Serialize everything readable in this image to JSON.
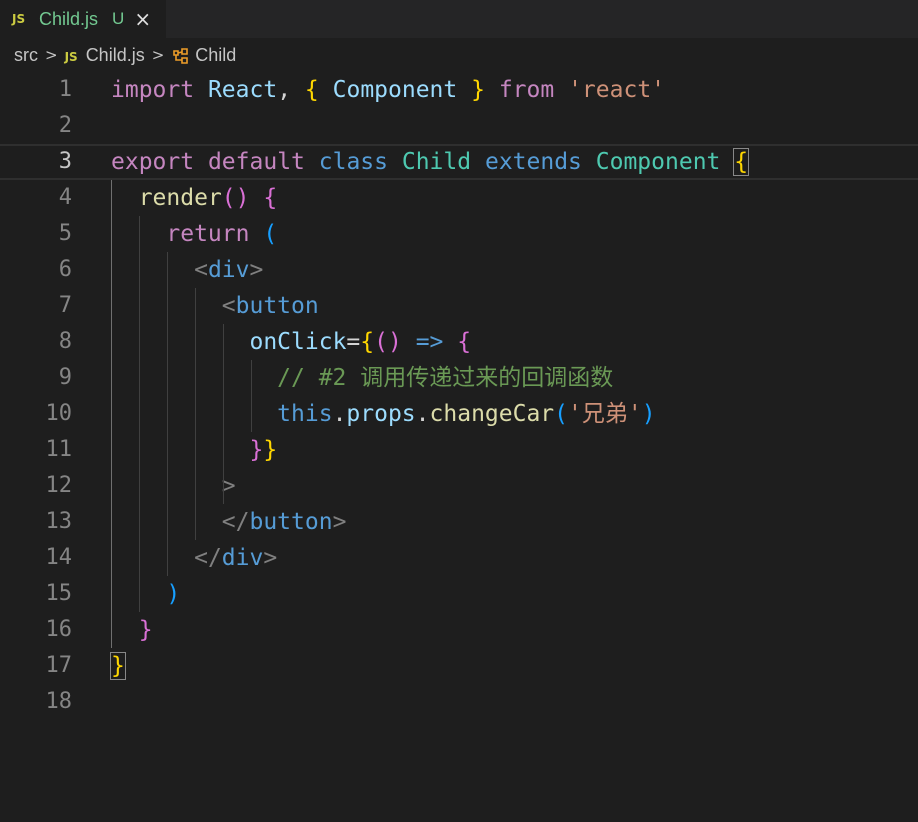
{
  "tab": {
    "badge": "JS",
    "filename": "Child.js",
    "status": "U",
    "close": "×"
  },
  "breadcrumb": {
    "folder": "src",
    "badge": "JS",
    "file": "Child.js",
    "symbol": "Child",
    "separator": ">"
  },
  "editor": {
    "active_line": 3,
    "line_numbers": [
      "1",
      "2",
      "3",
      "4",
      "5",
      "6",
      "7",
      "8",
      "9",
      "10",
      "11",
      "12",
      "13",
      "14",
      "15",
      "16",
      "17",
      "18"
    ],
    "lines": [
      [
        [
          "import",
          "kw-purple"
        ],
        [
          " ",
          "plain"
        ],
        [
          "React",
          "var"
        ],
        [
          ", ",
          "plain"
        ],
        [
          "{",
          "br1"
        ],
        [
          " ",
          "plain"
        ],
        [
          "Component",
          "var"
        ],
        [
          " ",
          "plain"
        ],
        [
          "}",
          "br1"
        ],
        [
          " ",
          "plain"
        ],
        [
          "from",
          "kw-purple"
        ],
        [
          " ",
          "plain"
        ],
        [
          "'react'",
          "str"
        ]
      ],
      [],
      [
        [
          "export",
          "kw-purple"
        ],
        [
          " ",
          "plain"
        ],
        [
          "default",
          "kw-purple"
        ],
        [
          " ",
          "plain"
        ],
        [
          "class",
          "kw-blue"
        ],
        [
          " ",
          "plain"
        ],
        [
          "Child",
          "type"
        ],
        [
          " ",
          "plain"
        ],
        [
          "extends",
          "kw-blue"
        ],
        [
          " ",
          "plain"
        ],
        [
          "Component",
          "type"
        ],
        [
          " ",
          "plain"
        ],
        [
          "{",
          "br1 bracket-match"
        ]
      ],
      [
        [
          "  ",
          "plain"
        ],
        [
          "render",
          "fn"
        ],
        [
          "()",
          "br2"
        ],
        [
          " ",
          "plain"
        ],
        [
          "{",
          "br2"
        ]
      ],
      [
        [
          "    ",
          "plain"
        ],
        [
          "return",
          "kw-purple"
        ],
        [
          " ",
          "plain"
        ],
        [
          "(",
          "br3"
        ]
      ],
      [
        [
          "      ",
          "plain"
        ],
        [
          "<",
          "angle"
        ],
        [
          "div",
          "tag"
        ],
        [
          ">",
          "angle"
        ]
      ],
      [
        [
          "        ",
          "plain"
        ],
        [
          "<",
          "angle"
        ],
        [
          "button",
          "tag"
        ]
      ],
      [
        [
          "          ",
          "plain"
        ],
        [
          "onClick",
          "var"
        ],
        [
          "=",
          "plain"
        ],
        [
          "{",
          "br1"
        ],
        [
          "()",
          "br2"
        ],
        [
          " ",
          "plain"
        ],
        [
          "=>",
          "kw-blue"
        ],
        [
          " ",
          "plain"
        ],
        [
          "{",
          "br2"
        ]
      ],
      [
        [
          "            ",
          "plain"
        ],
        [
          "// #2 调用传递过来的回调函数",
          "cmt"
        ]
      ],
      [
        [
          "            ",
          "plain"
        ],
        [
          "this",
          "kw-blue"
        ],
        [
          ".",
          "plain"
        ],
        [
          "props",
          "var"
        ],
        [
          ".",
          "plain"
        ],
        [
          "changeCar",
          "fn"
        ],
        [
          "(",
          "br3"
        ],
        [
          "'兄弟'",
          "str"
        ],
        [
          ")",
          "br3"
        ]
      ],
      [
        [
          "          ",
          "plain"
        ],
        [
          "}",
          "br2"
        ],
        [
          "}",
          "br1"
        ]
      ],
      [
        [
          "        ",
          "plain"
        ],
        [
          ">",
          "angle"
        ]
      ],
      [
        [
          "        ",
          "plain"
        ],
        [
          "</",
          "angle"
        ],
        [
          "button",
          "tag"
        ],
        [
          ">",
          "angle"
        ]
      ],
      [
        [
          "      ",
          "plain"
        ],
        [
          "</",
          "angle"
        ],
        [
          "div",
          "tag"
        ],
        [
          ">",
          "angle"
        ]
      ],
      [
        [
          "    ",
          "plain"
        ],
        [
          ")",
          "br3"
        ]
      ],
      [
        [
          "  ",
          "plain"
        ],
        [
          "}",
          "br2"
        ]
      ],
      [
        [
          "}",
          "br1 bracket-match"
        ]
      ],
      []
    ]
  },
  "colors": {
    "background": "#1e1e1e",
    "tabbar": "#252526",
    "git_untracked": "#73c991",
    "js_icon": "#cbcb41",
    "scope_indicator": "#b3a55a"
  },
  "icons": [
    "close-icon",
    "chevron-right-icon",
    "js-file-icon",
    "class-symbol-icon"
  ]
}
